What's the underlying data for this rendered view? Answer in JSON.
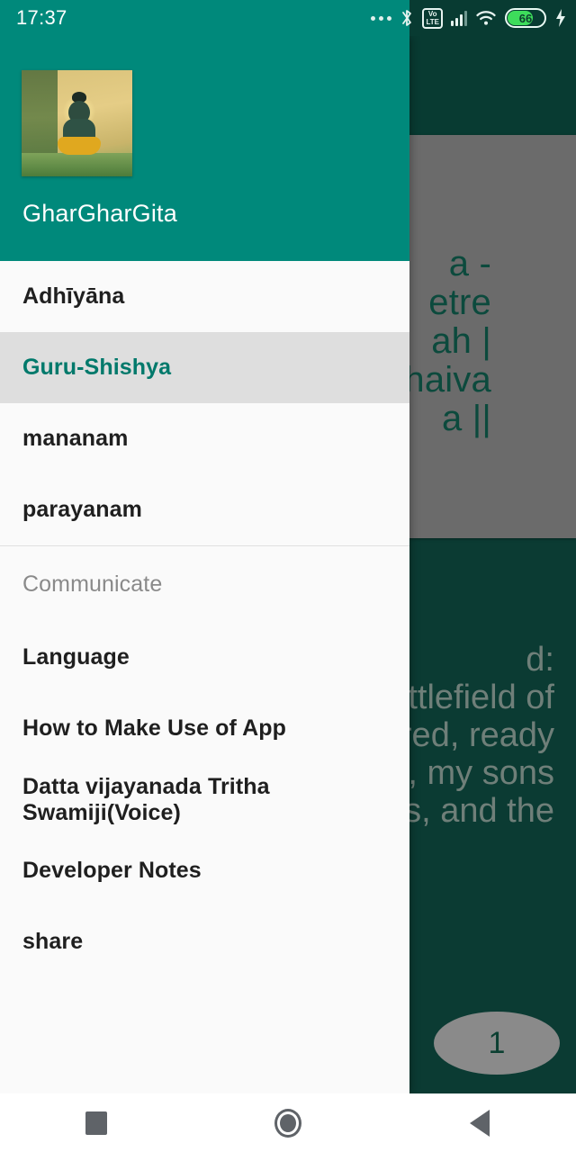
{
  "status_bar": {
    "time": "17:37",
    "icons": [
      "more-dots-icon",
      "bluetooth-icon",
      "volte-icon",
      "signal-bars-icon",
      "wifi-icon",
      "battery-icon",
      "charging-bolt-icon"
    ],
    "volte_top": "Vo",
    "volte_bottom": "LTE",
    "battery_percent": "66",
    "background_color": "#083b32",
    "drawer_tint_color": "#00897b"
  },
  "drawer": {
    "header": {
      "app_name": "GharGharGita",
      "logo_name": "krishna-thumbnail",
      "background_color": "#00897b"
    },
    "primary_items": [
      {
        "label": "Adhīyāna",
        "name": "sidebar-item-adhiyana",
        "selected": false
      },
      {
        "label": "Guru-Shishya",
        "name": "sidebar-item-guru-shishya",
        "selected": true
      },
      {
        "label": "mananam",
        "name": "sidebar-item-mananam",
        "selected": false
      },
      {
        "label": "parayanam",
        "name": "sidebar-item-parayanam",
        "selected": false
      }
    ],
    "section_header": "Communicate",
    "secondary_items": [
      {
        "label": "Language",
        "name": "sidebar-item-language"
      },
      {
        "label": "How to Make Use of App",
        "name": "sidebar-item-how-to-make-use-of-app"
      },
      {
        "label": "Datta vijayanada Tritha Swamiji(Voice)",
        "name": "sidebar-item-datta-vijayanada-tritha-swamiji-voice"
      },
      {
        "label": "Developer Notes",
        "name": "sidebar-item-developer-notes"
      },
      {
        "label": "share",
        "name": "sidebar-item-share"
      }
    ],
    "selected_color": "#00796b",
    "selected_row_background": "#dedede"
  },
  "background_app": {
    "verse_sanskrit": "a -\netre\nah |\nhaiva\na ||",
    "translation": "d:\nttlefield of\nred, ready\ne, my sons\ns, and the",
    "page_badge": "1",
    "app_bar_color": "#083b32",
    "card_color": "#6b6b6b",
    "page_background_color": "#0b3b33"
  },
  "nav_bar": {
    "buttons": [
      {
        "name": "recents-square-icon",
        "label": "Recents"
      },
      {
        "name": "home-circle-icon",
        "label": "Home"
      },
      {
        "name": "back-triangle-icon",
        "label": "Back"
      }
    ]
  }
}
